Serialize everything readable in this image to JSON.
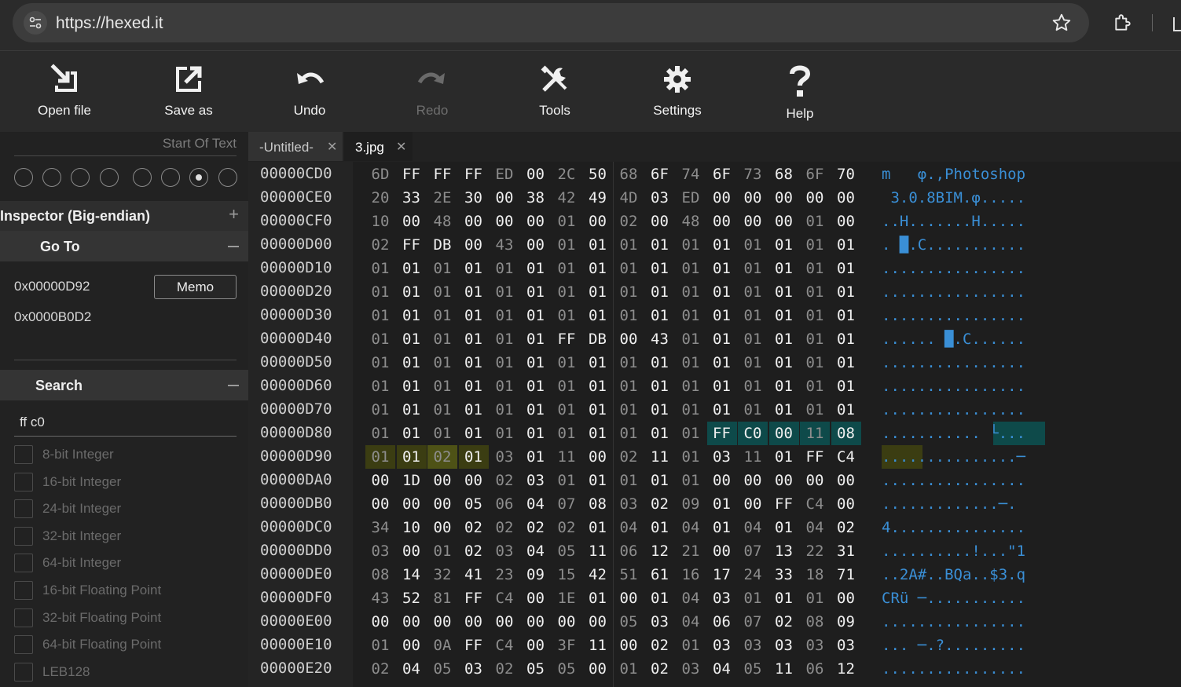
{
  "browser": {
    "url": "https://hexed.it"
  },
  "toolbar": {
    "open_file": "Open file",
    "save_as": "Save as",
    "undo": "Undo",
    "redo": "Redo",
    "tools": "Tools",
    "settings": "Settings",
    "help": "Help"
  },
  "sidebar": {
    "start_of_text": "Start Of Text",
    "inspector_title": "Inspector (Big-endian)",
    "goto_title": "Go To",
    "goto_address_1": "0x00000D92",
    "goto_address_2": "0x0000B0D2",
    "memo_label": "Memo",
    "search_title": "Search",
    "search_value": "ff c0",
    "search_options": [
      "8-bit Integer",
      "16-bit Integer",
      "24-bit Integer",
      "32-bit Integer",
      "64-bit Integer",
      "16-bit Floating Point",
      "32-bit Floating Point",
      "64-bit Floating Point",
      "LEB128"
    ]
  },
  "tabs": [
    {
      "label": "-Untitled-",
      "active": false
    },
    {
      "label": "3.jpg",
      "active": true
    }
  ],
  "hex_rows": [
    {
      "offset": "00000CD0",
      "bytes": [
        "6D",
        "FF",
        "FF",
        "FF",
        "ED",
        "00",
        "2C",
        "50",
        "68",
        "6F",
        "74",
        "6F",
        "73",
        "68",
        "6F",
        "70"
      ],
      "ascii": "m   φ.,Photoshop"
    },
    {
      "offset": "00000CE0",
      "bytes": [
        "20",
        "33",
        "2E",
        "30",
        "00",
        "38",
        "42",
        "49",
        "4D",
        "03",
        "ED",
        "00",
        "00",
        "00",
        "00",
        "00"
      ],
      "ascii": " 3.0.8BIM.φ....."
    },
    {
      "offset": "00000CF0",
      "bytes": [
        "10",
        "00",
        "48",
        "00",
        "00",
        "00",
        "01",
        "00",
        "02",
        "00",
        "48",
        "00",
        "00",
        "00",
        "01",
        "00"
      ],
      "ascii": "..H.......H....."
    },
    {
      "offset": "00000D00",
      "bytes": [
        "02",
        "FF",
        "DB",
        "00",
        "43",
        "00",
        "01",
        "01",
        "01",
        "01",
        "01",
        "01",
        "01",
        "01",
        "01",
        "01"
      ],
      "ascii": ". █.C..........."
    },
    {
      "offset": "00000D10",
      "bytes": [
        "01",
        "01",
        "01",
        "01",
        "01",
        "01",
        "01",
        "01",
        "01",
        "01",
        "01",
        "01",
        "01",
        "01",
        "01",
        "01"
      ],
      "ascii": "................"
    },
    {
      "offset": "00000D20",
      "bytes": [
        "01",
        "01",
        "01",
        "01",
        "01",
        "01",
        "01",
        "01",
        "01",
        "01",
        "01",
        "01",
        "01",
        "01",
        "01",
        "01"
      ],
      "ascii": "................"
    },
    {
      "offset": "00000D30",
      "bytes": [
        "01",
        "01",
        "01",
        "01",
        "01",
        "01",
        "01",
        "01",
        "01",
        "01",
        "01",
        "01",
        "01",
        "01",
        "01",
        "01"
      ],
      "ascii": "................"
    },
    {
      "offset": "00000D40",
      "bytes": [
        "01",
        "01",
        "01",
        "01",
        "01",
        "01",
        "FF",
        "DB",
        "00",
        "43",
        "01",
        "01",
        "01",
        "01",
        "01",
        "01"
      ],
      "ascii": "...... █.C......"
    },
    {
      "offset": "00000D50",
      "bytes": [
        "01",
        "01",
        "01",
        "01",
        "01",
        "01",
        "01",
        "01",
        "01",
        "01",
        "01",
        "01",
        "01",
        "01",
        "01",
        "01"
      ],
      "ascii": "................"
    },
    {
      "offset": "00000D60",
      "bytes": [
        "01",
        "01",
        "01",
        "01",
        "01",
        "01",
        "01",
        "01",
        "01",
        "01",
        "01",
        "01",
        "01",
        "01",
        "01",
        "01"
      ],
      "ascii": "................"
    },
    {
      "offset": "00000D70",
      "bytes": [
        "01",
        "01",
        "01",
        "01",
        "01",
        "01",
        "01",
        "01",
        "01",
        "01",
        "01",
        "01",
        "01",
        "01",
        "01",
        "01"
      ],
      "ascii": "................"
    },
    {
      "offset": "00000D80",
      "bytes": [
        "01",
        "01",
        "01",
        "01",
        "01",
        "01",
        "01",
        "01",
        "01",
        "01",
        "01",
        "FF",
        "C0",
        "00",
        "11",
        "08"
      ],
      "ascii": "........... └..."
    },
    {
      "offset": "00000D90",
      "bytes": [
        "01",
        "01",
        "02",
        "01",
        "03",
        "01",
        "11",
        "00",
        "02",
        "11",
        "01",
        "03",
        "11",
        "01",
        "FF",
        "C4"
      ],
      "ascii": "...............─"
    },
    {
      "offset": "00000DA0",
      "bytes": [
        "00",
        "1D",
        "00",
        "00",
        "02",
        "03",
        "01",
        "01",
        "01",
        "01",
        "01",
        "00",
        "00",
        "00",
        "00",
        "00"
      ],
      "ascii": "................"
    },
    {
      "offset": "00000DB0",
      "bytes": [
        "00",
        "00",
        "00",
        "05",
        "06",
        "04",
        "07",
        "08",
        "03",
        "02",
        "09",
        "01",
        "00",
        "FF",
        "C4",
        "00"
      ],
      "ascii": ".............─."
    },
    {
      "offset": "00000DC0",
      "bytes": [
        "34",
        "10",
        "00",
        "02",
        "02",
        "02",
        "02",
        "01",
        "04",
        "01",
        "04",
        "01",
        "04",
        "01",
        "04",
        "02"
      ],
      "ascii": "4..............."
    },
    {
      "offset": "00000DD0",
      "bytes": [
        "03",
        "00",
        "01",
        "02",
        "03",
        "04",
        "05",
        "11",
        "06",
        "12",
        "21",
        "00",
        "07",
        "13",
        "22",
        "31"
      ],
      "ascii": "..........!...\"1"
    },
    {
      "offset": "00000DE0",
      "bytes": [
        "08",
        "14",
        "32",
        "41",
        "23",
        "09",
        "15",
        "42",
        "51",
        "61",
        "16",
        "17",
        "24",
        "33",
        "18",
        "71"
      ],
      "ascii": "..2A#..BQa..$3.q"
    },
    {
      "offset": "00000DF0",
      "bytes": [
        "43",
        "52",
        "81",
        "FF",
        "C4",
        "00",
        "1E",
        "01",
        "00",
        "01",
        "04",
        "03",
        "01",
        "01",
        "01",
        "00"
      ],
      "ascii": "CRü ─..........."
    },
    {
      "offset": "00000E00",
      "bytes": [
        "00",
        "00",
        "00",
        "00",
        "00",
        "00",
        "00",
        "00",
        "05",
        "03",
        "04",
        "06",
        "07",
        "02",
        "08",
        "09"
      ],
      "ascii": "................"
    },
    {
      "offset": "00000E10",
      "bytes": [
        "01",
        "00",
        "0A",
        "FF",
        "C4",
        "00",
        "3F",
        "11",
        "00",
        "02",
        "01",
        "03",
        "03",
        "03",
        "03",
        "03"
      ],
      "ascii": "... ─.?........."
    },
    {
      "offset": "00000E20",
      "bytes": [
        "02",
        "04",
        "05",
        "03",
        "02",
        "05",
        "05",
        "00",
        "01",
        "02",
        "03",
        "04",
        "05",
        "11",
        "06",
        "12"
      ],
      "ascii": "................"
    }
  ]
}
